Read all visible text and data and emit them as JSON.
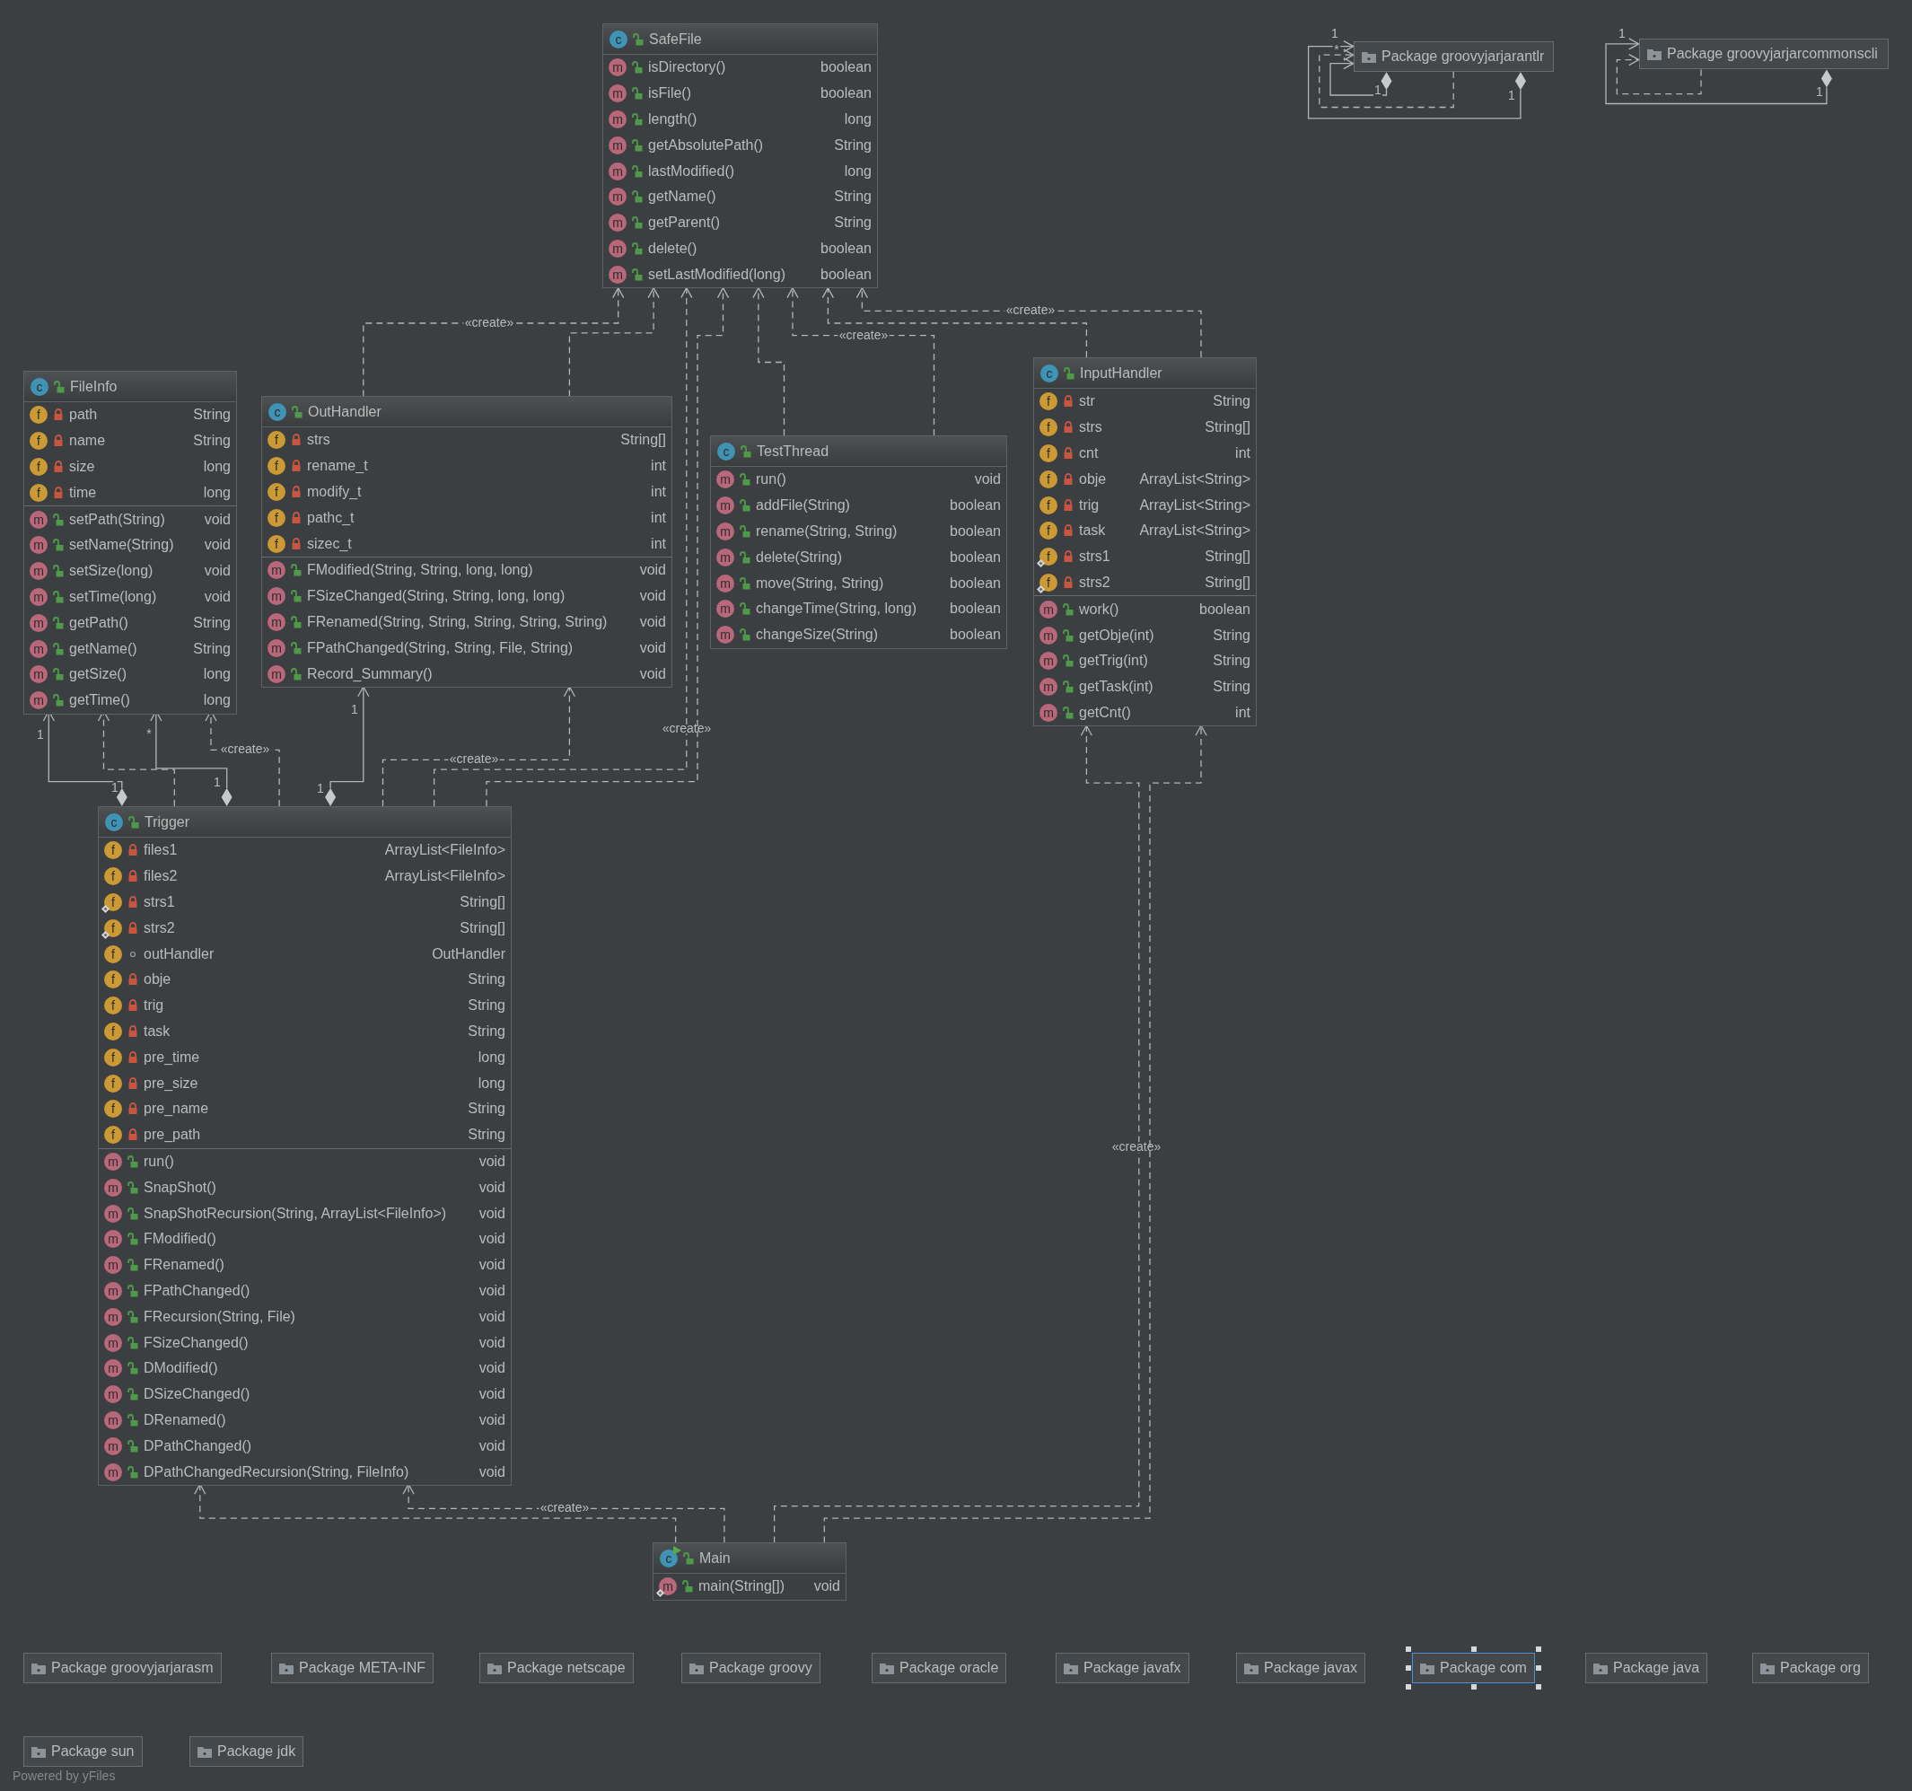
{
  "packages_top": [
    {
      "label": "Package groovyjarjarantlr",
      "selected": false
    },
    {
      "label": "Package groovyjarjarcommonscli",
      "selected": false
    }
  ],
  "classes": [
    {
      "name": "SafeFile",
      "kind": "class",
      "icon": "c",
      "public": true,
      "methods": [
        {
          "icon": "m",
          "kind": "public",
          "static": false,
          "name": "isDirectory()",
          "type": "boolean"
        },
        {
          "icon": "m",
          "kind": "public",
          "static": false,
          "name": "isFile()",
          "type": "boolean"
        },
        {
          "icon": "m",
          "kind": "public",
          "static": false,
          "name": "length()",
          "type": "long"
        },
        {
          "icon": "m",
          "kind": "public",
          "static": false,
          "name": "getAbsolutePath()",
          "type": "String"
        },
        {
          "icon": "m",
          "kind": "public",
          "static": false,
          "name": "lastModified()",
          "type": "long"
        },
        {
          "icon": "m",
          "kind": "public",
          "static": false,
          "name": "getName()",
          "type": "String"
        },
        {
          "icon": "m",
          "kind": "public",
          "static": false,
          "name": "getParent()",
          "type": "String"
        },
        {
          "icon": "m",
          "kind": "public",
          "static": false,
          "name": "delete()",
          "type": "boolean"
        },
        {
          "icon": "m",
          "kind": "public",
          "static": false,
          "name": "setLastModified(long)",
          "type": "boolean"
        }
      ]
    },
    {
      "name": "FileInfo",
      "kind": "class",
      "icon": "c",
      "public": true,
      "fields": [
        {
          "icon": "f",
          "kind": "private",
          "static": false,
          "name": "path",
          "type": "String"
        },
        {
          "icon": "f",
          "kind": "private",
          "static": false,
          "name": "name",
          "type": "String"
        },
        {
          "icon": "f",
          "kind": "private",
          "static": false,
          "name": "size",
          "type": "long"
        },
        {
          "icon": "f",
          "kind": "private",
          "static": false,
          "name": "time",
          "type": "long"
        }
      ],
      "methods": [
        {
          "icon": "m",
          "kind": "public",
          "static": false,
          "name": "setPath(String)",
          "type": "void"
        },
        {
          "icon": "m",
          "kind": "public",
          "static": false,
          "name": "setName(String)",
          "type": "void"
        },
        {
          "icon": "m",
          "kind": "public",
          "static": false,
          "name": "setSize(long)",
          "type": "void"
        },
        {
          "icon": "m",
          "kind": "public",
          "static": false,
          "name": "setTime(long)",
          "type": "void"
        },
        {
          "icon": "m",
          "kind": "public",
          "static": false,
          "name": "getPath()",
          "type": "String"
        },
        {
          "icon": "m",
          "kind": "public",
          "static": false,
          "name": "getName()",
          "type": "String"
        },
        {
          "icon": "m",
          "kind": "public",
          "static": false,
          "name": "getSize()",
          "type": "long"
        },
        {
          "icon": "m",
          "kind": "public",
          "static": false,
          "name": "getTime()",
          "type": "long"
        }
      ]
    },
    {
      "name": "OutHandler",
      "kind": "class",
      "icon": "c",
      "public": true,
      "fields": [
        {
          "icon": "f",
          "kind": "private",
          "static": false,
          "name": "strs",
          "type": "String[]"
        },
        {
          "icon": "f",
          "kind": "private",
          "static": false,
          "name": "rename_t",
          "type": "int"
        },
        {
          "icon": "f",
          "kind": "private",
          "static": false,
          "name": "modify_t",
          "type": "int"
        },
        {
          "icon": "f",
          "kind": "private",
          "static": false,
          "name": "pathc_t",
          "type": "int"
        },
        {
          "icon": "f",
          "kind": "private",
          "static": false,
          "name": "sizec_t",
          "type": "int"
        }
      ],
      "methods": [
        {
          "icon": "m",
          "kind": "public",
          "static": false,
          "name": "FModified(String, String, long, long)",
          "type": "void"
        },
        {
          "icon": "m",
          "kind": "public",
          "static": false,
          "name": "FSizeChanged(String, String, long, long)",
          "type": "void"
        },
        {
          "icon": "m",
          "kind": "public",
          "static": false,
          "name": "FRenamed(String, String, String, String, String)",
          "type": "void"
        },
        {
          "icon": "m",
          "kind": "public",
          "static": false,
          "name": "FPathChanged(String, String, File, String)",
          "type": "void"
        },
        {
          "icon": "m",
          "kind": "public",
          "static": false,
          "name": "Record_Summary()",
          "type": "void"
        }
      ]
    },
    {
      "name": "TestThread",
      "kind": "class",
      "icon": "c",
      "public": true,
      "methods": [
        {
          "icon": "m",
          "kind": "public",
          "static": false,
          "name": "run()",
          "type": "void"
        },
        {
          "icon": "m",
          "kind": "public",
          "static": false,
          "name": "addFile(String)",
          "type": "boolean"
        },
        {
          "icon": "m",
          "kind": "public",
          "static": false,
          "name": "rename(String, String)",
          "type": "boolean"
        },
        {
          "icon": "m",
          "kind": "public",
          "static": false,
          "name": "delete(String)",
          "type": "boolean"
        },
        {
          "icon": "m",
          "kind": "public",
          "static": false,
          "name": "move(String, String)",
          "type": "boolean"
        },
        {
          "icon": "m",
          "kind": "public",
          "static": false,
          "name": "changeTime(String, long)",
          "type": "boolean"
        },
        {
          "icon": "m",
          "kind": "public",
          "static": false,
          "name": "changeSize(String)",
          "type": "boolean"
        }
      ]
    },
    {
      "name": "InputHandler",
      "kind": "class",
      "icon": "c",
      "public": true,
      "fields": [
        {
          "icon": "f",
          "kind": "private",
          "static": false,
          "name": "str",
          "type": "String"
        },
        {
          "icon": "f",
          "kind": "private",
          "static": false,
          "name": "strs",
          "type": "String[]"
        },
        {
          "icon": "f",
          "kind": "private",
          "static": false,
          "name": "cnt",
          "type": "int"
        },
        {
          "icon": "f",
          "kind": "private",
          "static": false,
          "name": "obje",
          "type": "ArrayList<String>"
        },
        {
          "icon": "f",
          "kind": "private",
          "static": false,
          "name": "trig",
          "type": "ArrayList<String>"
        },
        {
          "icon": "f",
          "kind": "private",
          "static": false,
          "name": "task",
          "type": "ArrayList<String>"
        },
        {
          "icon": "f",
          "kind": "private",
          "static": true,
          "name": "strs1",
          "type": "String[]"
        },
        {
          "icon": "f",
          "kind": "private",
          "static": true,
          "name": "strs2",
          "type": "String[]"
        }
      ],
      "methods": [
        {
          "icon": "m",
          "kind": "public",
          "static": false,
          "name": "work()",
          "type": "boolean"
        },
        {
          "icon": "m",
          "kind": "public",
          "static": false,
          "name": "getObje(int)",
          "type": "String"
        },
        {
          "icon": "m",
          "kind": "public",
          "static": false,
          "name": "getTrig(int)",
          "type": "String"
        },
        {
          "icon": "m",
          "kind": "public",
          "static": false,
          "name": "getTask(int)",
          "type": "String"
        },
        {
          "icon": "m",
          "kind": "public",
          "static": false,
          "name": "getCnt()",
          "type": "int"
        }
      ]
    },
    {
      "name": "Trigger",
      "kind": "class",
      "icon": "c",
      "public": true,
      "fields": [
        {
          "icon": "f",
          "kind": "private",
          "static": false,
          "name": "files1",
          "type": "ArrayList<FileInfo>"
        },
        {
          "icon": "f",
          "kind": "private",
          "static": false,
          "name": "files2",
          "type": "ArrayList<FileInfo>"
        },
        {
          "icon": "f",
          "kind": "private",
          "static": true,
          "name": "strs1",
          "type": "String[]"
        },
        {
          "icon": "f",
          "kind": "private",
          "static": true,
          "name": "strs2",
          "type": "String[]"
        },
        {
          "icon": "f",
          "kind": "package",
          "static": false,
          "name": "outHandler",
          "type": "OutHandler"
        },
        {
          "icon": "f",
          "kind": "private",
          "static": false,
          "name": "obje",
          "type": "String"
        },
        {
          "icon": "f",
          "kind": "private",
          "static": false,
          "name": "trig",
          "type": "String"
        },
        {
          "icon": "f",
          "kind": "private",
          "static": false,
          "name": "task",
          "type": "String"
        },
        {
          "icon": "f",
          "kind": "private",
          "static": false,
          "name": "pre_time",
          "type": "long"
        },
        {
          "icon": "f",
          "kind": "private",
          "static": false,
          "name": "pre_size",
          "type": "long"
        },
        {
          "icon": "f",
          "kind": "private",
          "static": false,
          "name": "pre_name",
          "type": "String"
        },
        {
          "icon": "f",
          "kind": "private",
          "static": false,
          "name": "pre_path",
          "type": "String"
        }
      ],
      "methods": [
        {
          "icon": "m",
          "kind": "public",
          "static": false,
          "name": "run()",
          "type": "void"
        },
        {
          "icon": "m",
          "kind": "public",
          "static": false,
          "name": "SnapShot()",
          "type": "void"
        },
        {
          "icon": "m",
          "kind": "public",
          "static": false,
          "name": "SnapShotRecursion(String, ArrayList<FileInfo>)",
          "type": "void"
        },
        {
          "icon": "m",
          "kind": "public",
          "static": false,
          "name": "FModified()",
          "type": "void"
        },
        {
          "icon": "m",
          "kind": "public",
          "static": false,
          "name": "FRenamed()",
          "type": "void"
        },
        {
          "icon": "m",
          "kind": "public",
          "static": false,
          "name": "FPathChanged()",
          "type": "void"
        },
        {
          "icon": "m",
          "kind": "public",
          "static": false,
          "name": "FRecursion(String, File)",
          "type": "void"
        },
        {
          "icon": "m",
          "kind": "public",
          "static": false,
          "name": "FSizeChanged()",
          "type": "void"
        },
        {
          "icon": "m",
          "kind": "public",
          "static": false,
          "name": "DModified()",
          "type": "void"
        },
        {
          "icon": "m",
          "kind": "public",
          "static": false,
          "name": "DSizeChanged()",
          "type": "void"
        },
        {
          "icon": "m",
          "kind": "public",
          "static": false,
          "name": "DRenamed()",
          "type": "void"
        },
        {
          "icon": "m",
          "kind": "public",
          "static": false,
          "name": "DPathChanged()",
          "type": "void"
        },
        {
          "icon": "m",
          "kind": "public",
          "static": false,
          "name": "DPathChangedRecursion(String, FileInfo)",
          "type": "void"
        }
      ]
    },
    {
      "name": "Main",
      "kind": "main",
      "icon": "c",
      "public": true,
      "methods": [
        {
          "icon": "m",
          "kind": "public",
          "static": true,
          "name": "main(String[])",
          "type": "void"
        }
      ]
    }
  ],
  "edges": [
    {
      "kind": "composition",
      "source_multiplicity": "1",
      "target_multiplicity": "1"
    },
    {
      "kind": "dependency",
      "target_multiplicity": "*"
    },
    {
      "kind": "composition",
      "source_multiplicity": "1"
    },
    {
      "kind": "composition",
      "source_multiplicity": "1",
      "target_multiplicity": "1"
    },
    {
      "kind": "dependency"
    },
    {
      "kind": "create",
      "label": "«create»"
    },
    {
      "kind": "create",
      "label": "«create»"
    },
    {
      "kind": "dependency"
    },
    {
      "kind": "dependency"
    },
    {
      "kind": "dependency"
    },
    {
      "kind": "create",
      "label": "«create»"
    },
    {
      "kind": "dependency"
    },
    {
      "kind": "create",
      "label": "«create»"
    },
    {
      "kind": "composition",
      "source_multiplicity": "1",
      "target_multiplicity": "1"
    },
    {
      "kind": "dependency"
    },
    {
      "kind": "composition",
      "source_multiplicity": "1",
      "target_multiplicity": "*"
    },
    {
      "kind": "create",
      "label": "«create»"
    },
    {
      "kind": "composition",
      "source_multiplicity": "1",
      "target_multiplicity": "1"
    },
    {
      "kind": "create",
      "label": "«create»"
    },
    {
      "kind": "create",
      "label": "«create»"
    },
    {
      "kind": "dependency"
    },
    {
      "kind": "dependency"
    },
    {
      "kind": "create",
      "label": "«create»"
    }
  ],
  "packages": [
    {
      "label": "Package groovyjarjarasm",
      "selected": false
    },
    {
      "label": "Package META-INF",
      "selected": false
    },
    {
      "label": "Package netscape",
      "selected": false
    },
    {
      "label": "Package groovy",
      "selected": false
    },
    {
      "label": "Package oracle",
      "selected": false
    },
    {
      "label": "Package javafx",
      "selected": false
    },
    {
      "label": "Package javax",
      "selected": false
    },
    {
      "label": "Package com",
      "selected": true
    },
    {
      "label": "Package java",
      "selected": false
    },
    {
      "label": "Package org",
      "selected": false
    },
    {
      "label": "Package sun",
      "selected": false
    },
    {
      "label": "Package jdk",
      "selected": false
    }
  ],
  "footer": "Powered by yFiles"
}
